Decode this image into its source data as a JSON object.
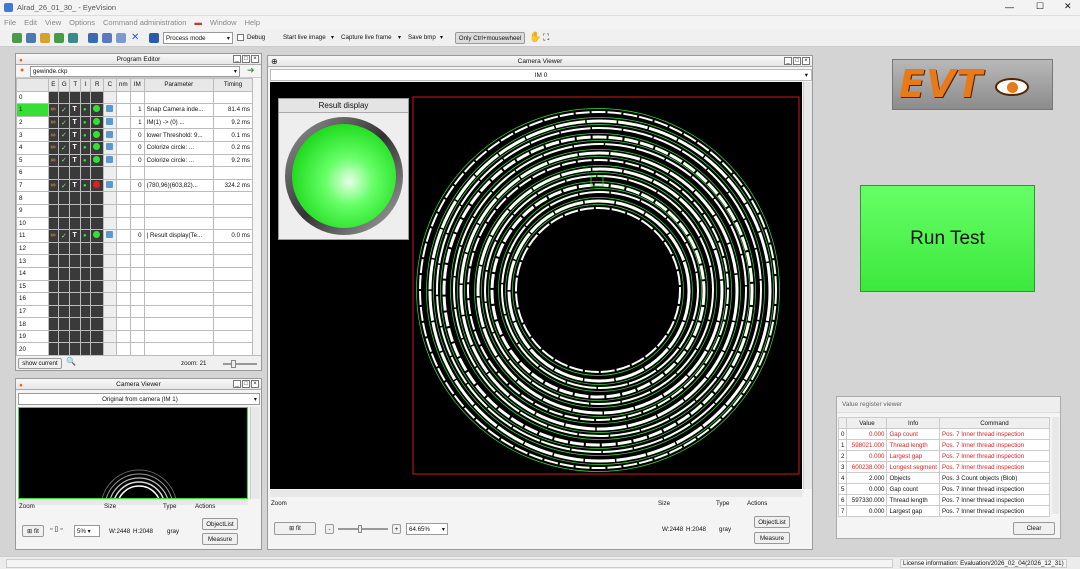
{
  "window": {
    "title": "Alrad_26_01_30_ - EyeVision"
  },
  "menu": [
    "File",
    "Edit",
    "View",
    "Options",
    "Command administration",
    "Window",
    "Help"
  ],
  "toolbar": {
    "mode_select": "Process mode",
    "debug_label": "Debug",
    "start_live": "Start live image",
    "capture_live": "Capture live frame",
    "save_bmp": "Save bmp",
    "only_ctrl": "Only Ctrl+mousewheel"
  },
  "program_editor": {
    "title": "Program Editor",
    "file": "gewinde.ckp",
    "columns": [
      "E",
      "G",
      "T",
      "I",
      "R",
      "C",
      "nm",
      "IM",
      "Parameter",
      "Timing"
    ],
    "rows": [
      {
        "n": "0",
        "im": "",
        "param": "",
        "timing": "",
        "active": false,
        "status": ""
      },
      {
        "n": "1",
        "im": "1",
        "param": "Snap Camera inde...",
        "timing": "81.4 ms",
        "active": true,
        "status": "green"
      },
      {
        "n": "2",
        "im": "1",
        "param": "IM(1) -> (0) ...",
        "timing": "9.2 ms",
        "active": true,
        "status": "green"
      },
      {
        "n": "3",
        "im": "0",
        "param": "lower Threshold: 9...",
        "timing": "0.1 ms",
        "active": true,
        "status": "green"
      },
      {
        "n": "4",
        "im": "0",
        "param": "Colorize circle: ...",
        "timing": "0.2 ms",
        "active": true,
        "status": "green"
      },
      {
        "n": "5",
        "im": "0",
        "param": "Colorize circle: ...",
        "timing": "9.2 ms",
        "active": true,
        "status": "green"
      },
      {
        "n": "6",
        "im": "",
        "param": "",
        "timing": "",
        "active": false,
        "status": ""
      },
      {
        "n": "7",
        "im": "0",
        "param": "(780,96)(603,82)...",
        "timing": "324.2 ms",
        "active": true,
        "status": "red"
      },
      {
        "n": "8",
        "im": "",
        "param": "",
        "timing": "",
        "active": false,
        "status": ""
      },
      {
        "n": "9",
        "im": "",
        "param": "",
        "timing": "",
        "active": false,
        "status": ""
      },
      {
        "n": "10",
        "im": "",
        "param": "",
        "timing": "",
        "active": false,
        "status": ""
      },
      {
        "n": "11",
        "im": "0",
        "param": "| Result display(Te...",
        "timing": "0.0 ms",
        "active": true,
        "status": "green"
      },
      {
        "n": "12",
        "im": "",
        "param": "",
        "timing": "",
        "active": false,
        "status": ""
      },
      {
        "n": "13",
        "im": "",
        "param": "",
        "timing": "",
        "active": false,
        "status": ""
      },
      {
        "n": "14",
        "im": "",
        "param": "",
        "timing": "",
        "active": false,
        "status": ""
      },
      {
        "n": "15",
        "im": "",
        "param": "",
        "timing": "",
        "active": false,
        "status": ""
      },
      {
        "n": "16",
        "im": "",
        "param": "",
        "timing": "",
        "active": false,
        "status": ""
      },
      {
        "n": "17",
        "im": "",
        "param": "",
        "timing": "",
        "active": false,
        "status": ""
      },
      {
        "n": "18",
        "im": "",
        "param": "",
        "timing": "",
        "active": false,
        "status": ""
      },
      {
        "n": "19",
        "im": "",
        "param": "",
        "timing": "",
        "active": false,
        "status": ""
      },
      {
        "n": "20",
        "im": "",
        "param": "",
        "timing": "",
        "active": false,
        "status": ""
      }
    ],
    "show_current": "show current",
    "zoom_label": "zoom: 21"
  },
  "small_camera": {
    "title": "Camera Viewer",
    "image_name": "Original from camera (IM 1)",
    "zoom_hdr": "Zoom",
    "size_hdr": "Size",
    "type_hdr": "Type",
    "actions_hdr": "Actions",
    "fit": "fit",
    "zoom_value": "5%",
    "size_w": "W:2448",
    "size_h": "H:2048",
    "type": "gray",
    "objectlist": "ObjectList",
    "measure": "Measure"
  },
  "main_camera": {
    "title": "Camera Viewer",
    "image_name": "IM 0",
    "result_display": "Result display",
    "zoom_hdr": "Zoom",
    "size_hdr": "Size",
    "type_hdr": "Type",
    "actions_hdr": "Actions",
    "fit": "fit",
    "minus": "-",
    "plus": "+",
    "zoom_value": "64.65%",
    "size_w": "W:2448",
    "size_h": "H:2048",
    "type": "gray",
    "objectlist": "ObjectList",
    "measure": "Measure"
  },
  "logo": {
    "text": "EVT"
  },
  "run_test": {
    "label": "Run Test"
  },
  "value_register": {
    "title": "Value register viewer",
    "columns": [
      "",
      "Value",
      "Info",
      "Command"
    ],
    "rows": [
      {
        "idx": "0",
        "value": "0.000",
        "info": "Gap count",
        "cmd_pos": "Pos.",
        "cmd": "7 Inner thread inspection",
        "red": true
      },
      {
        "idx": "1",
        "value": "598021.000",
        "info": "Thread length",
        "cmd_pos": "Pos.",
        "cmd": "7 Inner thread inspection",
        "red": true
      },
      {
        "idx": "2",
        "value": "0.000",
        "info": "Largest gap",
        "cmd_pos": "Pos.",
        "cmd": "7 Inner thread inspection",
        "red": true
      },
      {
        "idx": "3",
        "value": "600238.000",
        "info": "Longest segment",
        "cmd_pos": "Pos.",
        "cmd": "7 Inner thread inspection",
        "red": true
      },
      {
        "idx": "4",
        "value": "2.000",
        "info": "Objects",
        "cmd_pos": "Pos.",
        "cmd": "3 Count objects (Blob)",
        "red": false
      },
      {
        "idx": "5",
        "value": "0.000",
        "info": "Gap count",
        "cmd_pos": "Pos.",
        "cmd": "7 Inner thread inspection",
        "red": false
      },
      {
        "idx": "6",
        "value": "597330.000",
        "info": "Thread length",
        "cmd_pos": "Pos.",
        "cmd": "7 Inner thread inspection",
        "red": false
      },
      {
        "idx": "7",
        "value": "0.000",
        "info": "Largest gap",
        "cmd_pos": "Pos.",
        "cmd": "7 Inner thread inspection",
        "red": false
      }
    ],
    "clear": "Clear"
  },
  "status": {
    "license": "License information: Evaluation/2026_02_04(2026_12_31)"
  },
  "colors": {
    "accent_green": "#33e033",
    "status_red": "#e02020",
    "logo_orange": "#e87a1a"
  }
}
